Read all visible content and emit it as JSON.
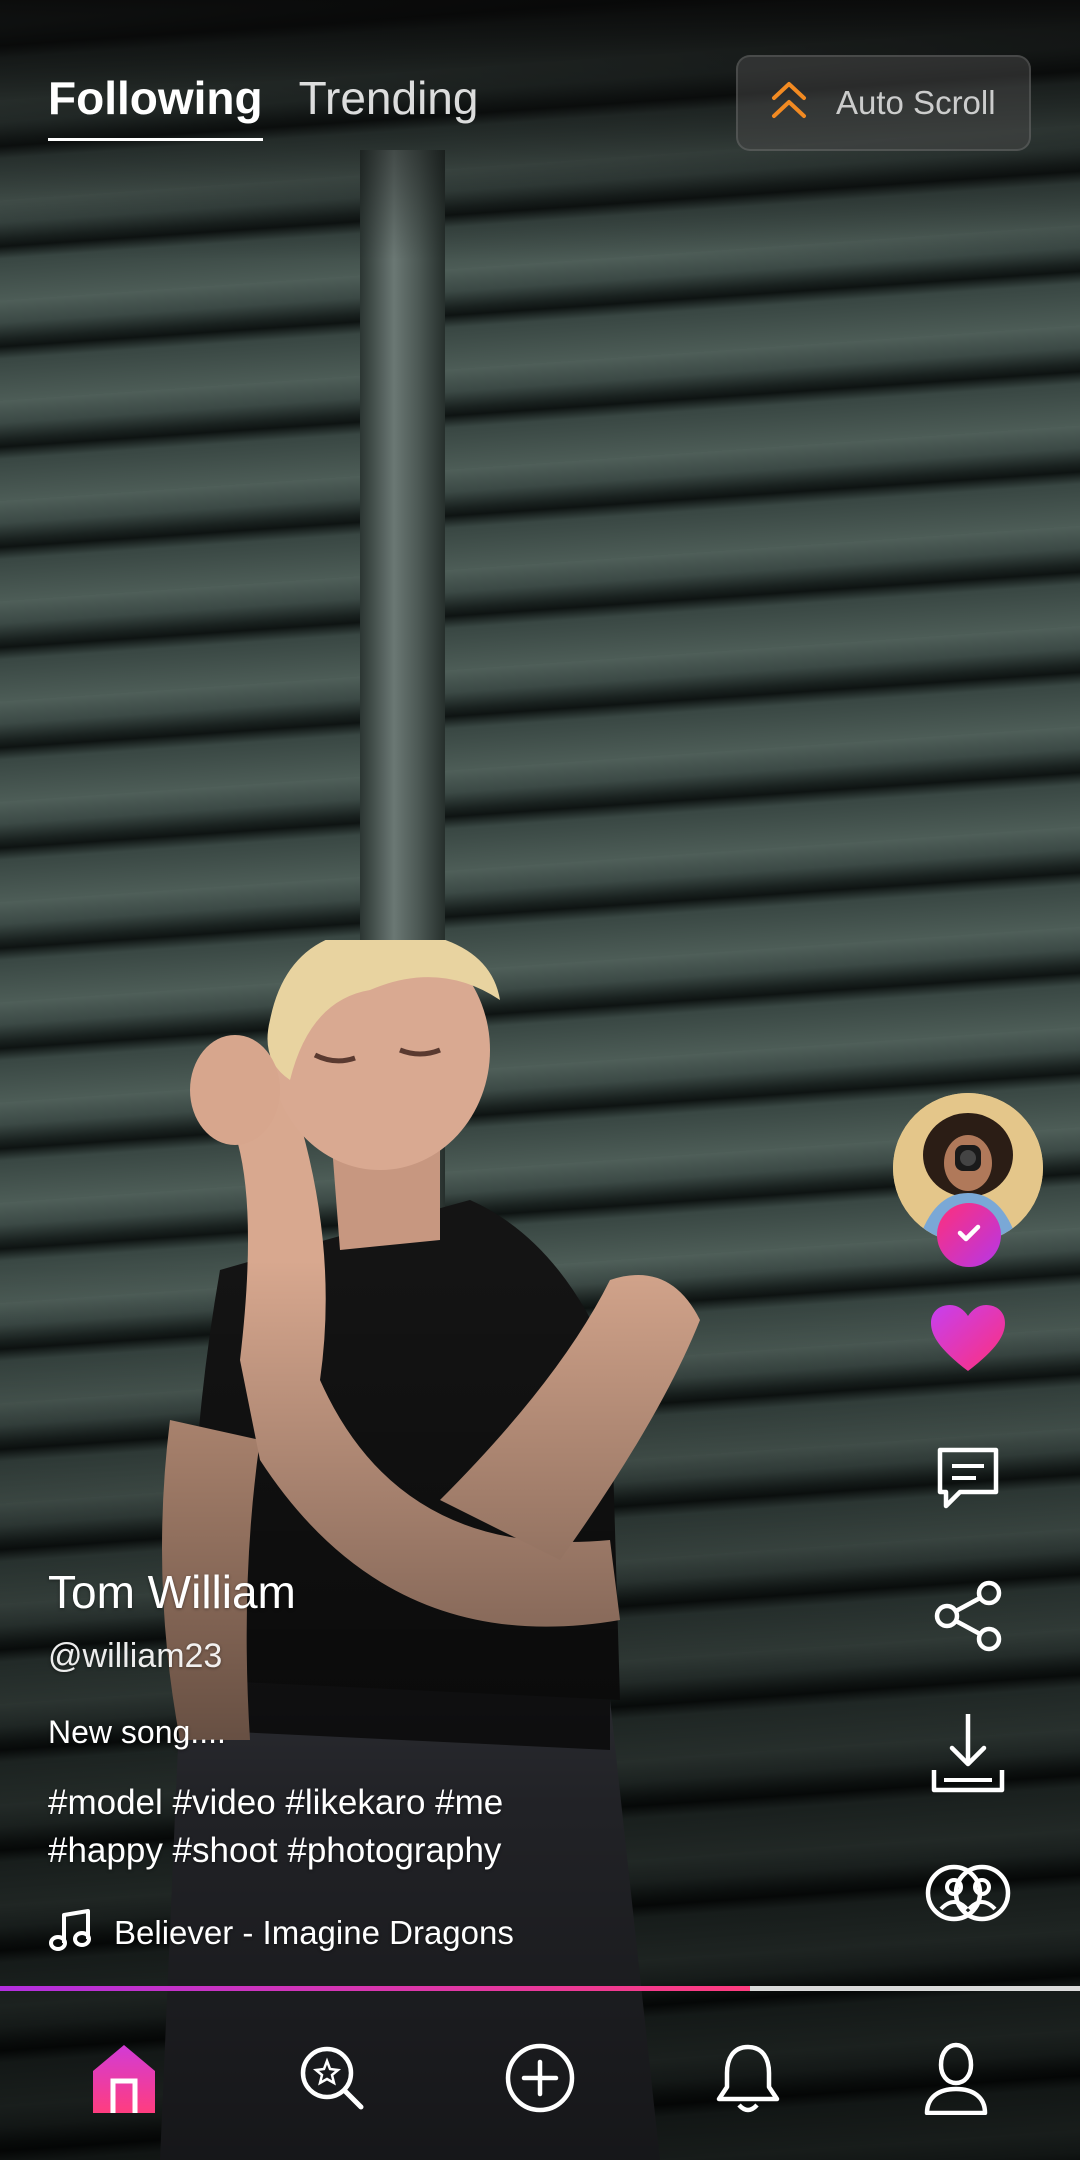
{
  "tabs": [
    {
      "label": "Following",
      "active": true
    },
    {
      "label": "Trending",
      "active": false
    }
  ],
  "auto_scroll": {
    "label": "Auto Scroll",
    "icon": "double-chevron-up-icon",
    "icon_color": "#f28a22"
  },
  "post": {
    "author_name": "Tom William",
    "handle": "@william23",
    "description": "New song....",
    "hashtags_line1": "#model #video #likekaro #me",
    "hashtags_line2": "#happy #shoot #photography",
    "music": "Believer - Imagine Dragons"
  },
  "actions": {
    "like_icon": "heart-icon",
    "comment_icon": "comment-icon",
    "share_icon": "share-icon",
    "download_icon": "download-icon",
    "duet_icon": "duet-icon",
    "verified_icon": "check-icon"
  },
  "progress": {
    "fraction": 0.694
  },
  "bottom_nav": [
    {
      "name": "home",
      "icon": "home-icon",
      "active": true
    },
    {
      "name": "discover",
      "icon": "search-icon",
      "active": false
    },
    {
      "name": "create",
      "icon": "add-icon",
      "active": false
    },
    {
      "name": "notifications",
      "icon": "bell-icon",
      "active": false
    },
    {
      "name": "profile",
      "icon": "user-icon",
      "active": false
    }
  ],
  "colors": {
    "accent_start": "#b32fe0",
    "accent_end": "#ff3d7f"
  }
}
